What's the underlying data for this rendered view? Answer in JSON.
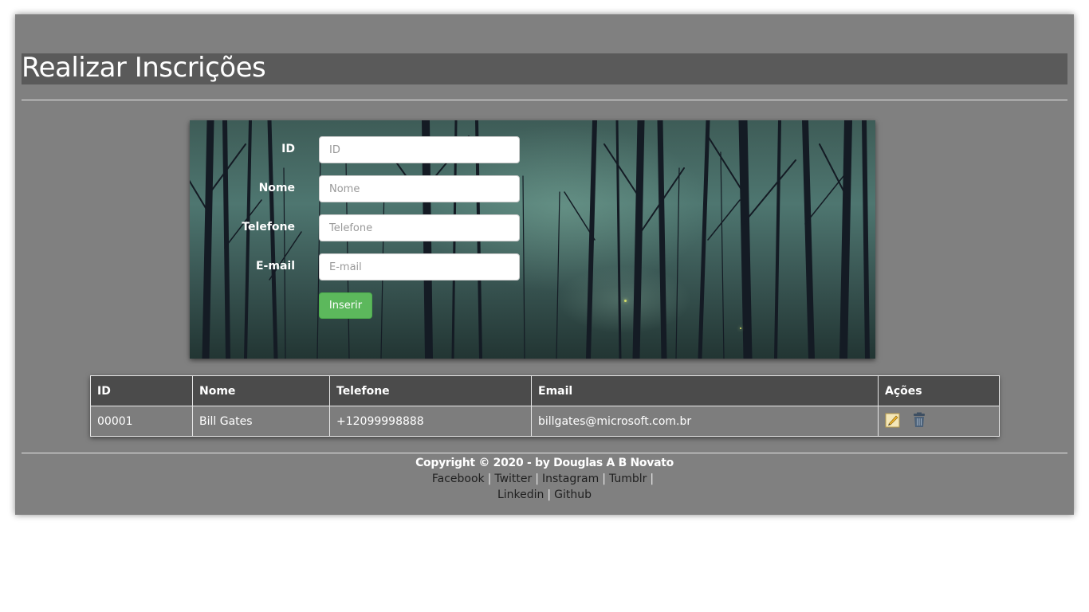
{
  "page": {
    "title": "Realizar Inscrições"
  },
  "form": {
    "fields": [
      {
        "label": "ID",
        "placeholder": "ID",
        "value": ""
      },
      {
        "label": "Nome",
        "placeholder": "Nome",
        "value": ""
      },
      {
        "label": "Telefone",
        "placeholder": "Telefone",
        "value": ""
      },
      {
        "label": "E-mail",
        "placeholder": "E-mail",
        "value": ""
      }
    ],
    "submit_label": "Inserir"
  },
  "table": {
    "headers": [
      "ID",
      "Nome",
      "Telefone",
      "Email",
      "Ações"
    ],
    "rows": [
      {
        "id": "00001",
        "nome": "Bill Gates",
        "telefone": "+12099998888",
        "email": "billgates@microsoft.com.br",
        "actions": [
          "edit-icon",
          "trash-icon"
        ]
      }
    ]
  },
  "footer": {
    "copyright": "Copyright © 2020 - by Douglas A B Novato",
    "links": [
      "Facebook",
      "Twitter",
      "Instagram",
      "Tumblr",
      "Linkedin",
      "Github"
    ],
    "separator": "|"
  },
  "colors": {
    "card_bg": "#808080",
    "title_bar": "#5a5a5a",
    "button_green": "#5cb85c",
    "table_header": "#4b4b4b"
  }
}
